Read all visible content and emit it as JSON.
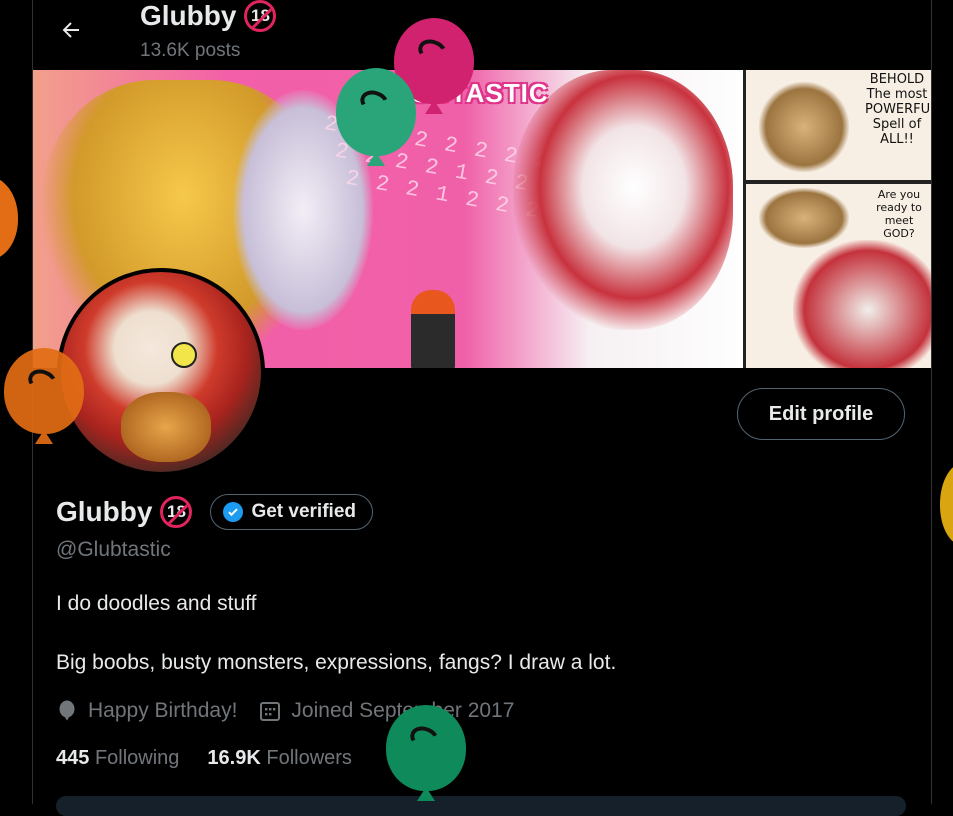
{
  "header": {
    "name": "Glubby",
    "age_badge": "18",
    "posts": "13.6K posts"
  },
  "banner": {
    "logo": "GLUBTASTIC",
    "stripe_text": "2 1 2 2 2 2 2 2 2\n 2 2 2 2 1 2 2 2 2 2\n  2 2 2 1 2 2 2 2 2 1",
    "caption_top": "BEHOLD\nThe most\nPOWERFUL\nSpell of\nALL!!",
    "caption_bottom": "Are you\nready to\nmeet GOD?"
  },
  "profile": {
    "name": "Glubby",
    "age_badge": "18",
    "get_verified": "Get verified",
    "edit_profile": "Edit profile",
    "handle": "@Glubtastic",
    "bio_line1": "I do doodles and stuff",
    "bio_line2": "Big boobs, busty monsters, expressions, fangs? I draw a lot.",
    "birthday": "Happy Birthday!",
    "joined": "Joined September 2017",
    "following_count": "445",
    "following_label": "Following",
    "followers_count": "16.9K",
    "followers_label": "Followers"
  },
  "icons": {
    "back": "arrow-left-icon",
    "verified": "verified-check-icon",
    "birthday": "balloon-icon",
    "calendar": "calendar-icon"
  },
  "colors": {
    "background": "#000000",
    "text_primary": "#e7e9ea",
    "text_secondary": "#71767b",
    "border": "#536471",
    "accent": "#1d9bf0",
    "badge_red": "#e0245e",
    "balloon_pink": "#d0226e",
    "balloon_teal": "#2aa57a",
    "balloon_orange": "#e26d14",
    "balloon_green": "#0f8a5a",
    "balloon_yellow": "#d9a511"
  }
}
